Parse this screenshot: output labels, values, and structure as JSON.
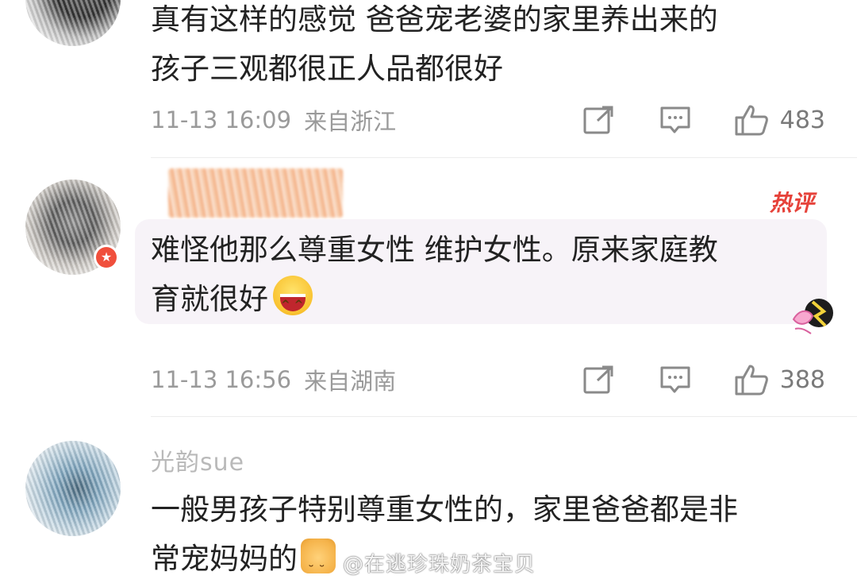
{
  "comments": [
    {
      "username": "",
      "text_lines": [
        "真有这样的感觉 爸爸宠老婆的家里养出来的",
        "孩子三观都很正人品都很好"
      ],
      "time": "11-13 16:09",
      "location": "来自浙江",
      "likes": "483"
    },
    {
      "username": "",
      "badge": "热评",
      "text_lines": [
        "难怪他那么尊重女性 维护女性。原来家庭教",
        "育就很好"
      ],
      "time": "11-13 16:56",
      "location": "来自湖南",
      "likes": "388"
    },
    {
      "username": "光韵sue",
      "text_lines": [
        "一般男孩子特别尊重女性的，家里爸爸都是非",
        "常宠妈妈的"
      ]
    }
  ],
  "icons": {
    "share": "share-icon",
    "reply": "comment-icon",
    "like": "thumbs-up-icon",
    "laugh": "laughing-emoji-icon",
    "cat": "cat-emoji-icon",
    "vip": "vip-badge-icon"
  },
  "colors": {
    "hot_tag": "#e6423a",
    "meta_text": "#9a9a9a",
    "bubble_bg": "#f7f3f8"
  },
  "watermark": "@在逃珍珠奶茶宝贝"
}
